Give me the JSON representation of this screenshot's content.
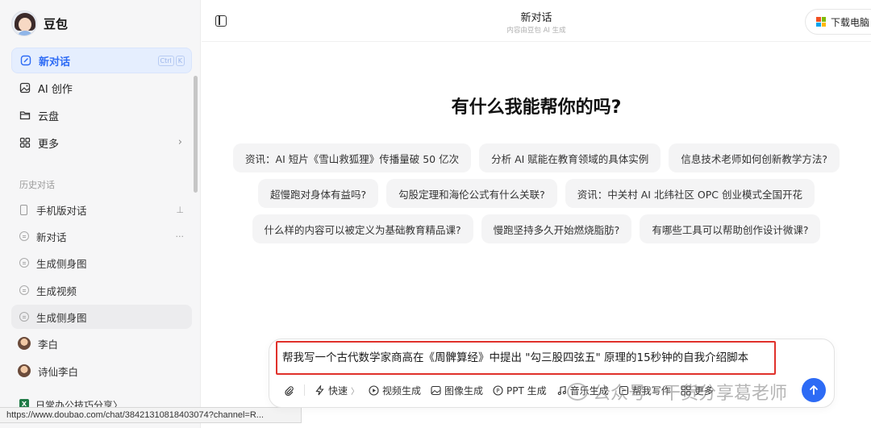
{
  "app": {
    "name": "豆包"
  },
  "sidebar": {
    "new_chat": "新对话",
    "shortcut": [
      "Ctrl",
      "K"
    ],
    "items": [
      {
        "label": "AI 创作",
        "icon": "image-icon"
      },
      {
        "label": "云盘",
        "icon": "folder-icon"
      },
      {
        "label": "更多",
        "icon": "grid-icon"
      }
    ],
    "history_title": "历史对话",
    "history": [
      {
        "label": "手机版对话",
        "icon": "phone-icon",
        "action": "pin-icon"
      },
      {
        "label": "新对话",
        "icon": "chat-bubble-icon",
        "action": "more-icon"
      },
      {
        "label": "生成侧身图",
        "icon": "chat-bubble-icon"
      },
      {
        "label": "生成视频",
        "icon": "chat-bubble-icon"
      },
      {
        "label": "生成侧身图",
        "icon": "chat-bubble-icon"
      },
      {
        "label": "李白",
        "icon": "avatar-icon"
      },
      {
        "label": "诗仙李白",
        "icon": "avatar-icon"
      }
    ],
    "folder_label": "日常办公技巧分享〉"
  },
  "status_url": "https://www.doubao.com/chat/38421310818403074?channel=R...",
  "header": {
    "title": "新对话",
    "subtitle": "内容由豆包 AI 生成",
    "download_label": "下载电脑"
  },
  "main": {
    "heading": "有什么我能帮你的吗?",
    "suggestions": [
      [
        "资讯：AI 短片《雪山救狐狸》传播量破 50 亿次",
        "分析 AI 赋能在教育领域的具体实例",
        "信息技术老师如何创新教学方法?"
      ],
      [
        "超慢跑对身体有益吗?",
        "勾股定理和海伦公式有什么关联?",
        "资讯：中关村 AI 北纬社区 OPC 创业模式全国开花"
      ],
      [
        "什么样的内容可以被定义为基础教育精品课?",
        "慢跑坚持多久开始燃烧脂肪?",
        "有哪些工具可以帮助创作设计微课?"
      ]
    ]
  },
  "composer": {
    "text": "帮我写一个古代数学家商高在《周髀算经》中提出 \"勾三股四弦五\" 原理的15秒钟的自我介绍脚本",
    "tools": [
      {
        "label": "快速",
        "icon": "lightning-icon",
        "suffix": "〉"
      },
      {
        "label": "视频生成",
        "icon": "video-icon"
      },
      {
        "label": "图像生成",
        "icon": "image-icon"
      },
      {
        "label": "PPT 生成",
        "icon": "ppt-icon"
      },
      {
        "label": "音乐生成",
        "icon": "music-icon"
      },
      {
        "label": "帮我写作",
        "icon": "write-icon"
      },
      {
        "label": "更多",
        "icon": "grid-icon"
      }
    ]
  },
  "watermark": "公众号 · 干货分享葛老师",
  "colors": {
    "accent": "#2d6bf5",
    "highlight_border": "#e0312b",
    "sidebar_bg": "#f6f6f7"
  }
}
